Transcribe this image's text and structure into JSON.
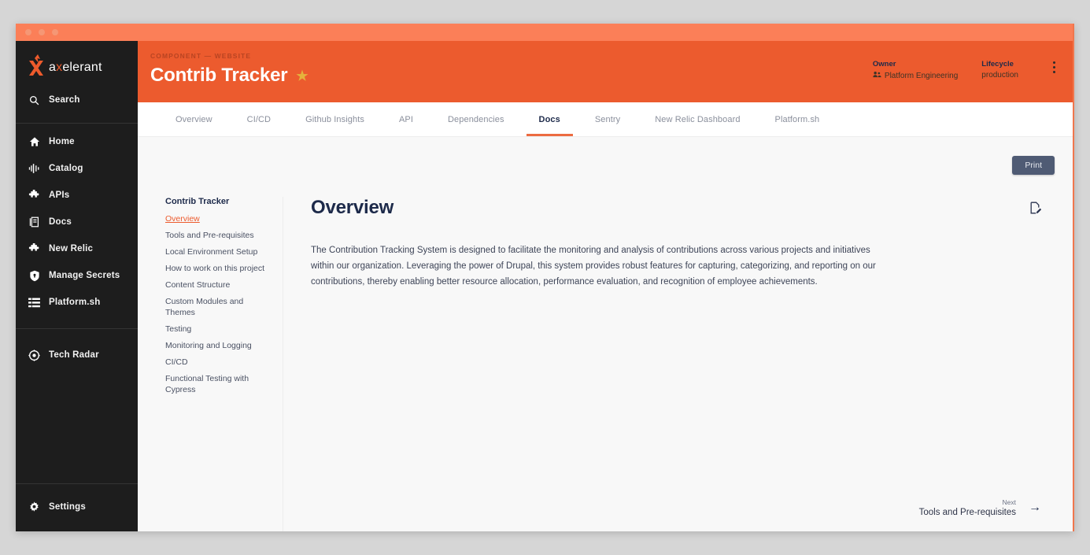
{
  "window": {
    "traffic_lights": [
      "close",
      "minimize",
      "maximize"
    ]
  },
  "sidebar": {
    "logo_text_pre": "a",
    "logo_text_x": "x",
    "logo_text_post": "elerant",
    "search": {
      "label": "Search",
      "icon": "search-icon"
    },
    "items": [
      {
        "label": "Home",
        "icon": "home-icon"
      },
      {
        "label": "Catalog",
        "icon": "catalog-icon"
      },
      {
        "label": "APIs",
        "icon": "puzzle-icon"
      },
      {
        "label": "Docs",
        "icon": "docs-icon"
      },
      {
        "label": "New Relic",
        "icon": "puzzle-icon"
      },
      {
        "label": "Manage Secrets",
        "icon": "shield-icon"
      },
      {
        "label": "Platform.sh",
        "icon": "layers-icon"
      }
    ],
    "secondary_items": [
      {
        "label": "Tech Radar",
        "icon": "radar-icon"
      }
    ],
    "footer_items": [
      {
        "label": "Settings",
        "icon": "gear-icon"
      }
    ]
  },
  "header": {
    "breadcrumb": "COMPONENT — WEBSITE",
    "title": "Contrib Tracker",
    "star_icon": "★",
    "owner": {
      "label": "Owner",
      "value": "Platform Engineering",
      "icon": "group-icon"
    },
    "lifecycle": {
      "label": "Lifecycle",
      "value": "production"
    },
    "more_menu": "kebab-menu-icon",
    "accent_color": "#ec5b2e"
  },
  "tabs": [
    {
      "label": "Overview",
      "active": false
    },
    {
      "label": "CI/CD",
      "active": false
    },
    {
      "label": "Github Insights",
      "active": false
    },
    {
      "label": "API",
      "active": false
    },
    {
      "label": "Dependencies",
      "active": false
    },
    {
      "label": "Docs",
      "active": true
    },
    {
      "label": "Sentry",
      "active": false
    },
    {
      "label": "New Relic Dashboard",
      "active": false
    },
    {
      "label": "Platform.sh",
      "active": false
    }
  ],
  "content": {
    "print_button": "Print",
    "toc": {
      "title": "Contrib Tracker",
      "items": [
        {
          "label": "Overview",
          "active": true
        },
        {
          "label": "Tools and Pre-requisites",
          "active": false
        },
        {
          "label": "Local Environment Setup",
          "active": false
        },
        {
          "label": "How to work on this project",
          "active": false
        },
        {
          "label": "Content Structure",
          "active": false
        },
        {
          "label": "Custom Modules and Themes",
          "active": false
        },
        {
          "label": "Testing",
          "active": false
        },
        {
          "label": "Monitoring and Logging",
          "active": false
        },
        {
          "label": "CI/CD",
          "active": false
        },
        {
          "label": "Functional Testing with Cypress",
          "active": false
        }
      ]
    },
    "heading": "Overview",
    "edit_icon": "edit-document-icon",
    "paragraph": "The Contribution Tracking System is designed to facilitate the monitoring and analysis of contributions across various projects and initiatives within our organization. Leveraging the power of Drupal, this system provides robust features for capturing, categorizing, and reporting on our contributions, thereby enabling better resource allocation, performance evaluation, and recognition of employee achievements.",
    "next_nav": {
      "label": "Next",
      "title": "Tools and Pre-requisites",
      "arrow": "→"
    }
  }
}
